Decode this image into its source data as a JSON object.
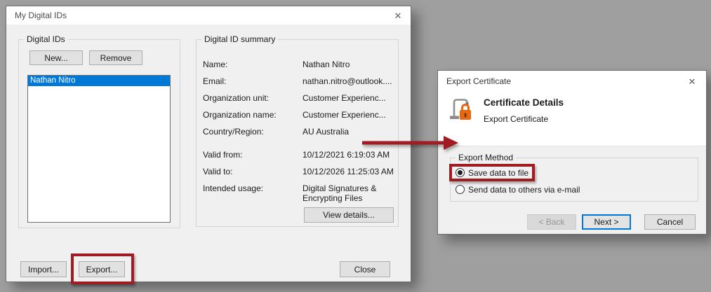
{
  "colors": {
    "annotation_red": "#a11b22",
    "selection_blue": "#0078d7",
    "focus_border_blue": "#0078d7",
    "lock_orange": "#e8680f",
    "dialog_background": "#f0f0f0",
    "desktop_background": "#9f9f9f"
  },
  "icons": {
    "close": "✕",
    "certificate": "certificate-lock-icon",
    "arrow": "red-arrow-right"
  },
  "left_dialog": {
    "title": "My Digital IDs",
    "ids_group": {
      "label": "Digital IDs",
      "new_button": "New...",
      "remove_button": "Remove",
      "items": [
        "Nathan Nitro"
      ],
      "selected_item": "Nathan Nitro"
    },
    "summary_group": {
      "label": "Digital ID summary",
      "fields": [
        {
          "label": "Name:",
          "value": "Nathan Nitro"
        },
        {
          "label": "Email:",
          "value": "nathan.nitro@outlook...."
        },
        {
          "label": "Organization unit:",
          "value": "Customer Experienc..."
        },
        {
          "label": "Organization name:",
          "value": "Customer Experienc..."
        },
        {
          "label": "Country/Region:",
          "value": "AU Australia"
        },
        {
          "label": "Valid from:",
          "value": "10/12/2021 6:19:03 AM"
        },
        {
          "label": "Valid to:",
          "value": "10/12/2026 11:25:03 AM"
        },
        {
          "label": "Intended usage:",
          "value": "Digital Signatures &",
          "value_line2": "Encrypting Files"
        }
      ],
      "view_details_button": "View details..."
    },
    "footer": {
      "import_button": "Import...",
      "export_button": "Export...",
      "close_button": "Close"
    }
  },
  "right_dialog": {
    "title": "Export Certificate",
    "header": {
      "heading": "Certificate Details",
      "subheading": "Export Certificate"
    },
    "method_group": {
      "label": "Export Method",
      "options": [
        {
          "label": "Save data to file",
          "selected": true
        },
        {
          "label": "Send data to others via e-mail",
          "selected": false
        }
      ]
    },
    "buttons": {
      "back": "< Back",
      "next": "Next >",
      "cancel": "Cancel"
    }
  }
}
